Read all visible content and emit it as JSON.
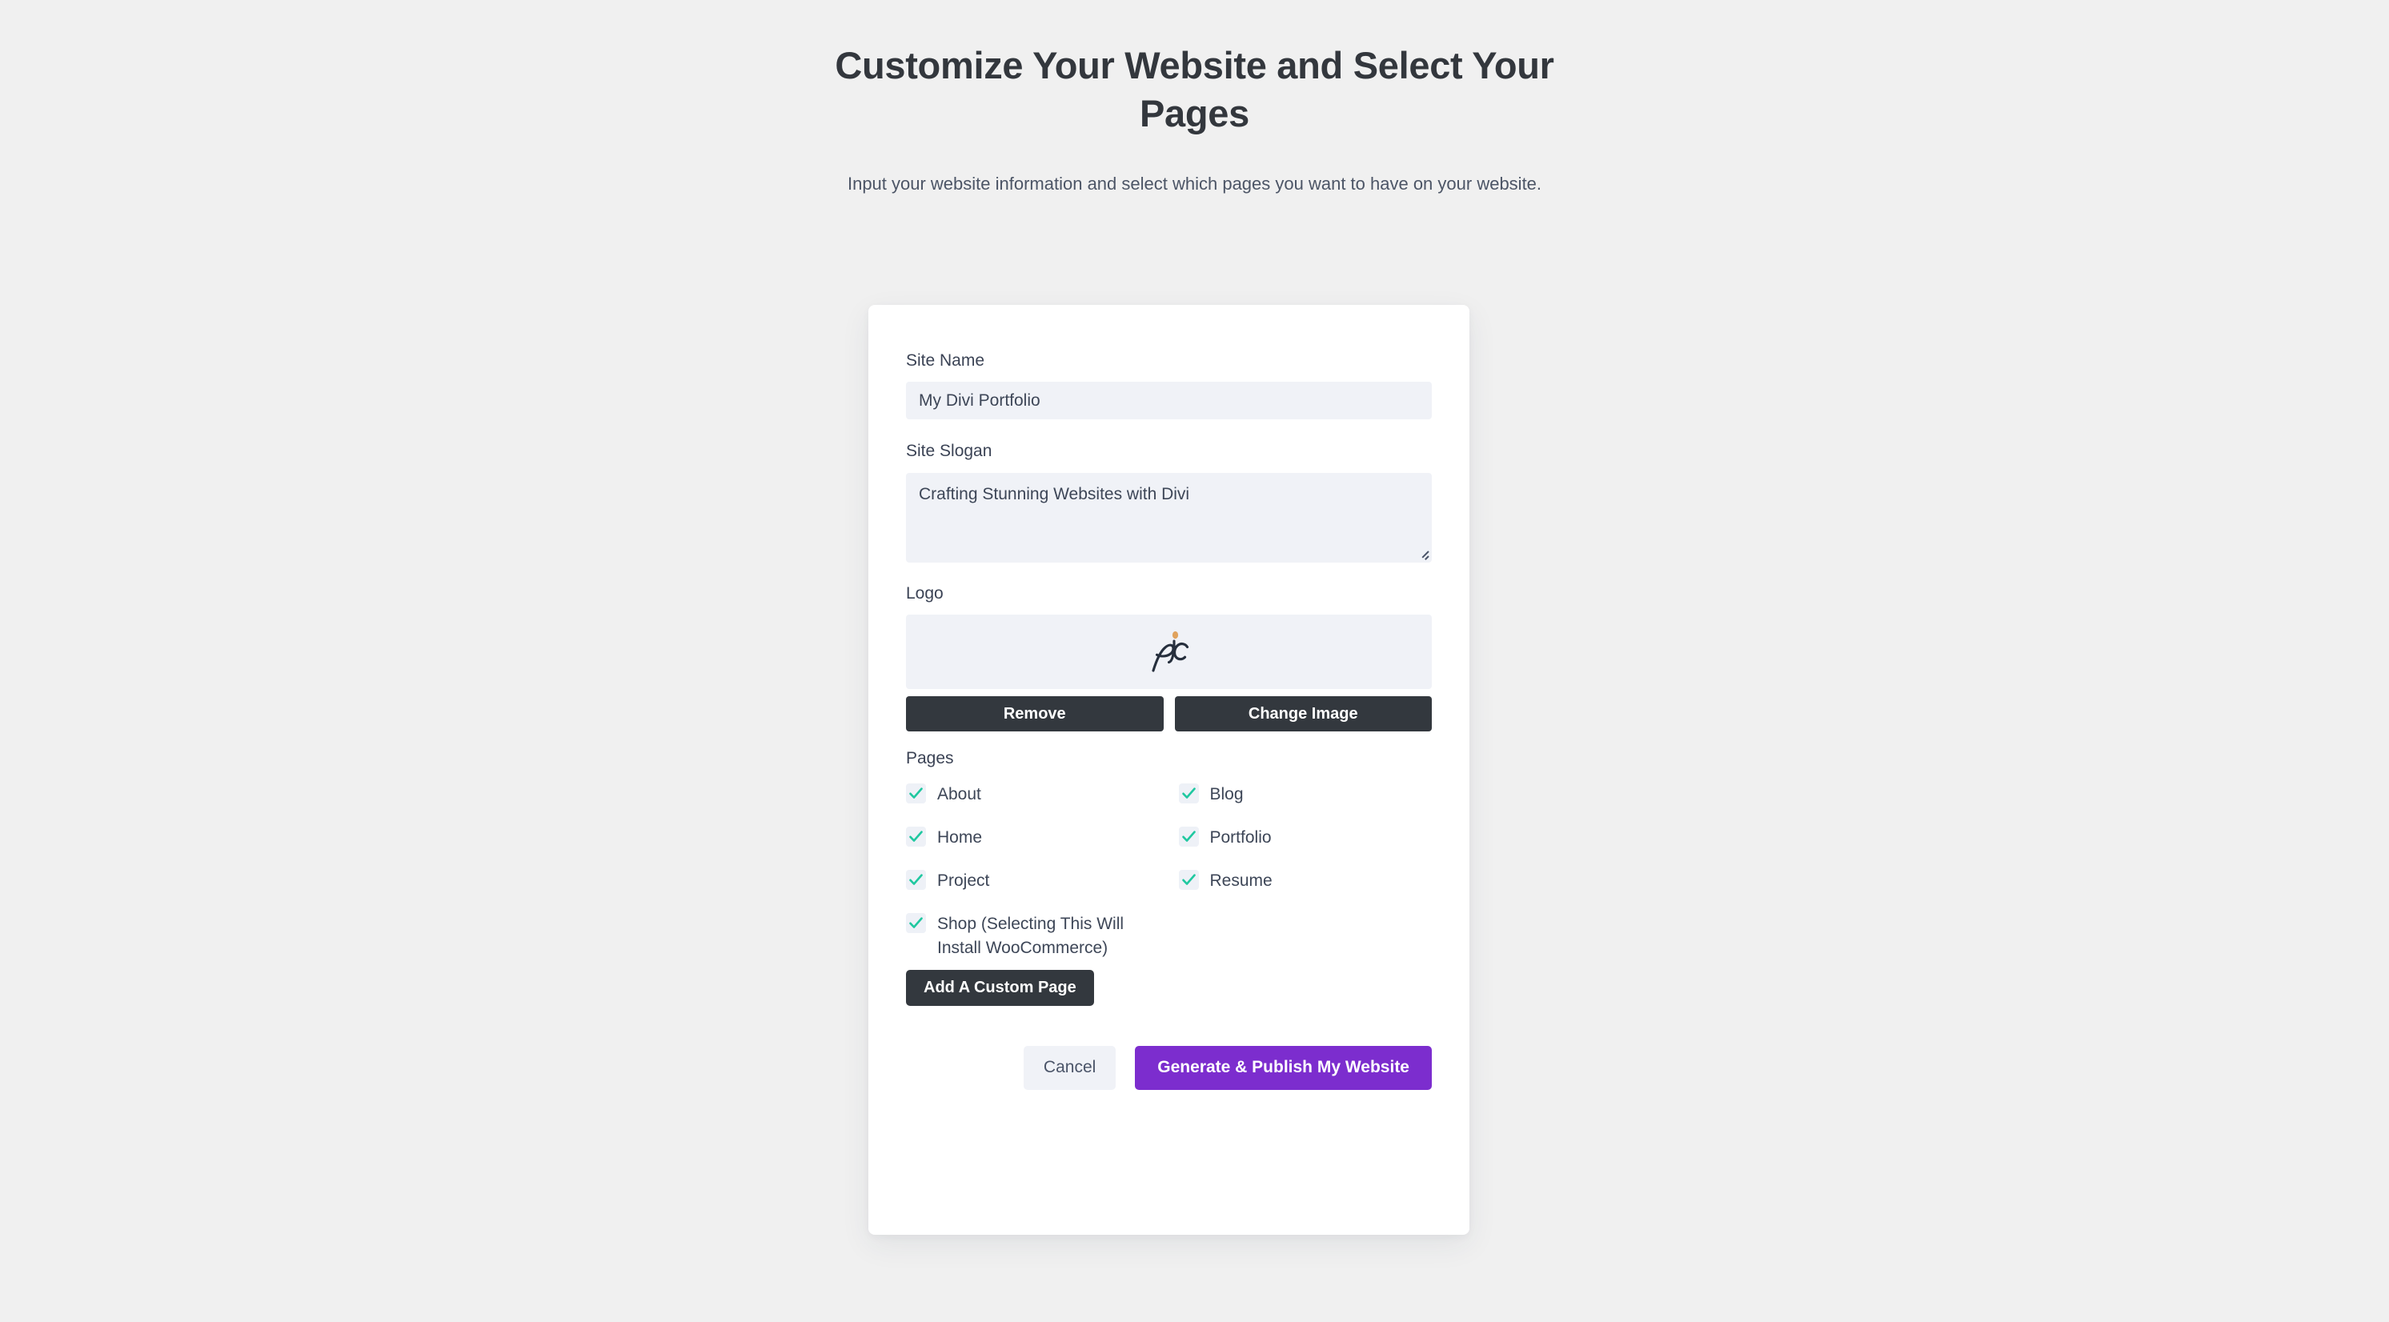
{
  "header": {
    "title": "Customize Your Website and Select Your Pages",
    "subtitle": "Input your website information and select which pages you want to have on your website."
  },
  "form": {
    "site_name": {
      "label": "Site Name",
      "value": "My Divi Portfolio",
      "placeholder": "Site Name"
    },
    "site_slogan": {
      "label": "Site Slogan",
      "value": "Crafting Stunning Websites with Divi",
      "placeholder": "Site Slogan"
    },
    "logo": {
      "label": "Logo",
      "icon": "pc-signature-logo",
      "remove_label": "Remove",
      "change_label": "Change Image"
    },
    "pages": {
      "label": "Pages",
      "items": [
        {
          "label": "About",
          "checked": true
        },
        {
          "label": "Blog",
          "checked": true
        },
        {
          "label": "Home",
          "checked": true
        },
        {
          "label": "Portfolio",
          "checked": true
        },
        {
          "label": "Project",
          "checked": true
        },
        {
          "label": "Resume",
          "checked": true
        },
        {
          "label": "Shop (Selecting This Will Install WooCommerce)",
          "checked": true
        }
      ],
      "add_custom_page_label": "Add A Custom Page"
    }
  },
  "actions": {
    "cancel_label": "Cancel",
    "submit_label": "Generate & Publish My Website"
  },
  "colors": {
    "page_background": "#f0f0f0",
    "card_background": "#ffffff",
    "input_background": "#f0f2f7",
    "dark_button": "#33383e",
    "primary_button": "#7c2dce",
    "checkmark": "#1fc8a0",
    "logo_accent": "#e0a35e",
    "logo_ink": "#262f3d",
    "text_primary": "#33373d",
    "text_secondary": "#4c5566"
  }
}
